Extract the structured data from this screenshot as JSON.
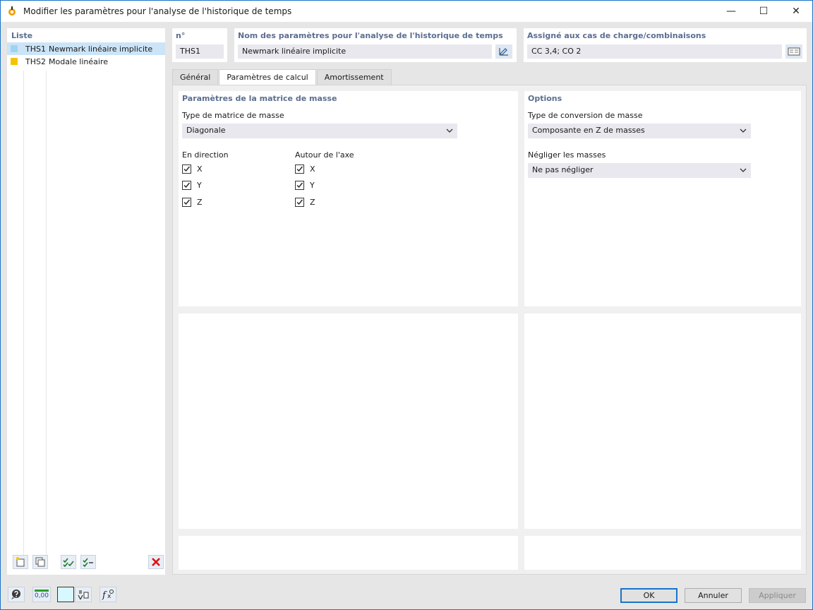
{
  "window": {
    "title": "Modifier les paramètres pour l'analyse de l'historique de temps",
    "minimize": "—",
    "maximize": "☐",
    "close": "✕"
  },
  "list": {
    "header": "Liste",
    "items": [
      {
        "code": "THS1",
        "name": "Newmark linéaire implicite",
        "color": "#9fd4f0",
        "selected": true
      },
      {
        "code": "THS2",
        "name": "Modale linéaire",
        "color": "#f5c400",
        "selected": false
      }
    ]
  },
  "fields": {
    "number_label": "n°",
    "number_value": "THS1",
    "name_label": "Nom des paramètres pour l'analyse de l'historique de temps",
    "name_value": "Newmark linéaire implicite",
    "assigned_label": "Assigné aux cas de charge/combinaisons",
    "assigned_value": "CC 3,4; CO 2"
  },
  "tabs": [
    {
      "label": "Général",
      "active": false
    },
    {
      "label": "Paramètres de calcul",
      "active": true
    },
    {
      "label": "Amortissement",
      "active": false
    }
  ],
  "mass_matrix": {
    "title": "Paramètres de la matrice de masse",
    "type_label": "Type de matrice de masse",
    "type_value": "Diagonale",
    "direction_label": "En direction",
    "axis_label": "Autour de l'axe",
    "direction": [
      {
        "label": "X",
        "checked": true
      },
      {
        "label": "Y",
        "checked": true
      },
      {
        "label": "Z",
        "checked": true
      }
    ],
    "axis": [
      {
        "label": "X",
        "checked": true
      },
      {
        "label": "Y",
        "checked": true
      },
      {
        "label": "Z",
        "checked": true
      }
    ]
  },
  "options": {
    "title": "Options",
    "conversion_label": "Type de conversion de masse",
    "conversion_value": "Composante en Z de masses",
    "neglect_label": "Négliger les masses",
    "neglect_value": "Ne pas négliger"
  },
  "buttons": {
    "ok": "OK",
    "cancel": "Annuler",
    "apply": "Appliquer",
    "units_icon_text": "0,00"
  },
  "colors": {
    "accent": "#1a73c6",
    "section_title": "#5b6e8f",
    "selected_row": "#cce4f7"
  }
}
